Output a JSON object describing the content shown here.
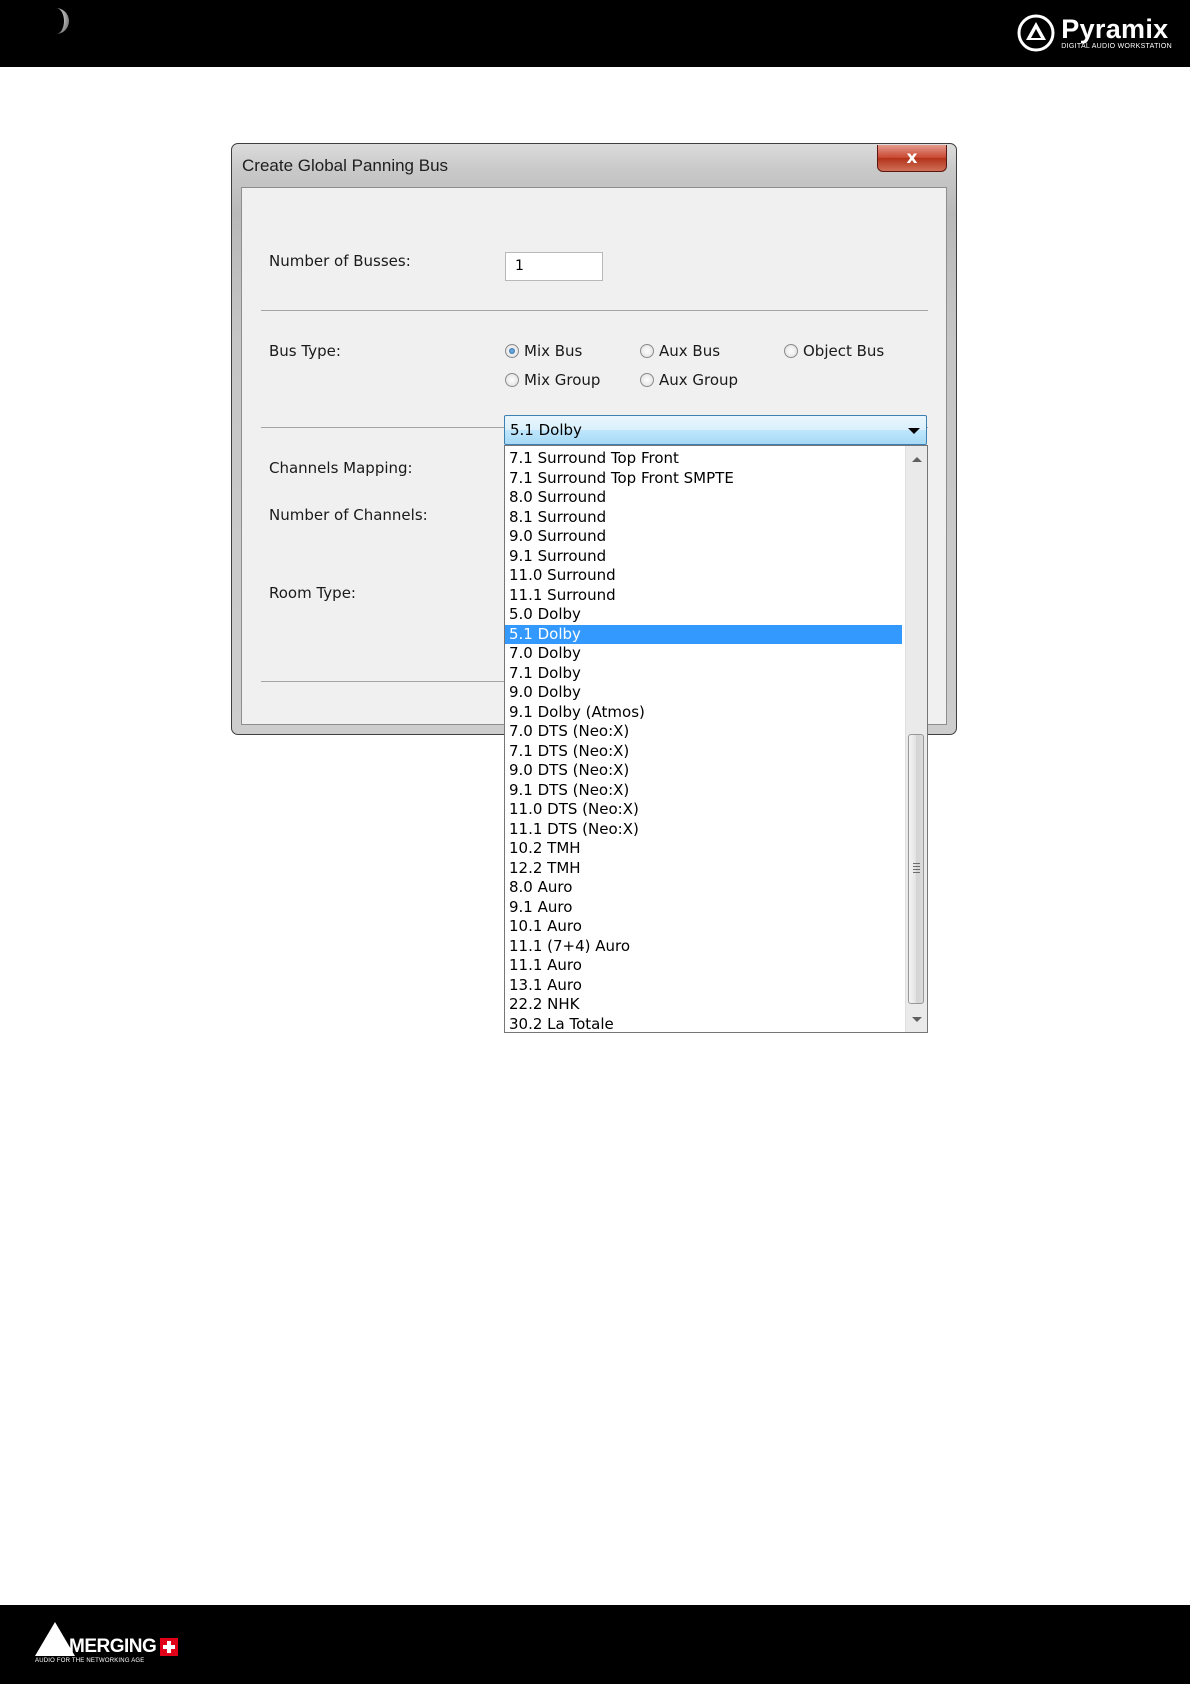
{
  "brand": {
    "name": "Pyramix",
    "subtitle": "DIGITAL AUDIO WORKSTATION",
    "footer_name": "MERGING",
    "footer_tagline": "AUDIO FOR THE NETWORKING AGE",
    "footer_cross_color": "#e1001a"
  },
  "dialog": {
    "title": "Create Global Panning Bus",
    "close_label": "x",
    "number_of_busses_label": "Number of Busses:",
    "number_of_busses_value": "1",
    "bus_type_label": "Bus Type:",
    "bus_types": {
      "mix_bus": "Mix Bus",
      "aux_bus": "Aux Bus",
      "object_bus": "Object Bus",
      "mix_group": "Mix Group",
      "aux_group": "Aux Group"
    },
    "selected_bus_type": "Mix Bus",
    "channels_mapping_label": "Channels Mapping:",
    "channels_mapping_value": "5.1 Dolby",
    "number_of_channels_label": "Number of Channels:",
    "room_type_label": "Room Type:"
  },
  "dropdown": {
    "selected_index": 9,
    "selection_color": "#3399ff",
    "items": [
      "7.1 Surround Top Front",
      "7.1 Surround Top Front SMPTE",
      "8.0 Surround",
      "8.1 Surround",
      "9.0 Surround",
      "9.1 Surround",
      "11.0 Surround",
      "11.1 Surround",
      "5.0 Dolby",
      "5.1 Dolby",
      "7.0 Dolby",
      "7.1 Dolby",
      "9.0 Dolby",
      "9.1 Dolby (Atmos)",
      "7.0 DTS (Neo:X)",
      "7.1 DTS (Neo:X)",
      "9.0 DTS (Neo:X)",
      "9.1 DTS (Neo:X)",
      "11.0 DTS (Neo:X)",
      "11.1 DTS (Neo:X)",
      "10.2 TMH",
      "12.2 TMH",
      "8.0 Auro",
      "9.1 Auro",
      "10.1 Auro",
      "11.1 (7+4) Auro",
      "11.1 Auro",
      "13.1 Auro",
      "22.2 NHK",
      "30.2 La Totale"
    ]
  }
}
